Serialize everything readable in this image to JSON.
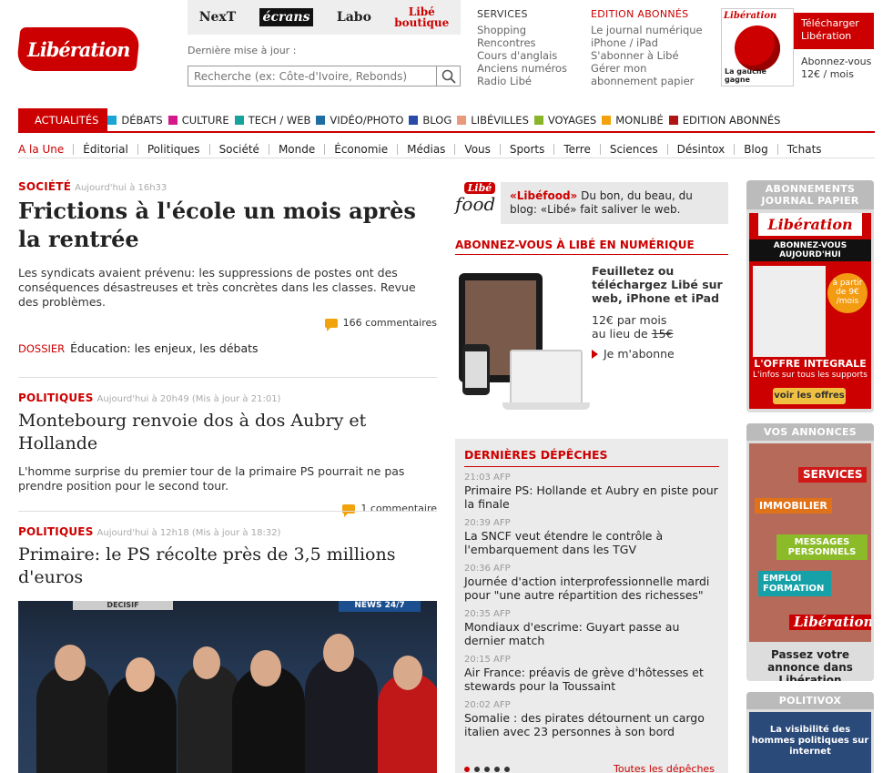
{
  "header": {
    "logo": "Libération",
    "brands": [
      "NexT",
      "écrans",
      "Labo",
      "Libé boutique"
    ],
    "last_update_label": "Dernière mise à jour :",
    "search_placeholder": "Recherche (ex: Côte-d'Ivoire, Rebonds)",
    "services": {
      "title": "SERVICES",
      "links": [
        "Shopping",
        "Rencontres",
        "Cours d'anglais",
        "Anciens numéros",
        "Radio Libé"
      ]
    },
    "abonnes": {
      "title": "EDITION ABONNÉS",
      "links": [
        "Le journal numérique",
        "iPhone / iPad",
        "S'abonner à Libé",
        "Gérer mon",
        "abonnement papier"
      ]
    },
    "cover_title": "Libération",
    "cover_caption": "La gauche gagne",
    "download": "Télécharger Libération",
    "subscribe_price": [
      "Abonnez-vous",
      "12€ / mois"
    ]
  },
  "nav": {
    "items": [
      {
        "label": "ACTUALITÉS",
        "color": "#cc0000"
      },
      {
        "label": "DÉBATS",
        "color": "#19a6d6"
      },
      {
        "label": "CULTURE",
        "color": "#d6198a"
      },
      {
        "label": "TECH / WEB",
        "color": "#17a39b"
      },
      {
        "label": "VIDÉO/PHOTO",
        "color": "#1f6ea3"
      },
      {
        "label": "BLOG",
        "color": "#2a4aa8"
      },
      {
        "label": "LIBÉVILLES",
        "color": "#e89a7a"
      },
      {
        "label": "VOYAGES",
        "color": "#8ab52a"
      },
      {
        "label": "MONLIBÉ",
        "color": "#f2a20a"
      },
      {
        "label": "EDITION ABONNÉS",
        "color": "#b01515"
      }
    ],
    "sub": [
      "A la Une",
      "Éditorial",
      "Politiques",
      "Société",
      "Monde",
      "Économie",
      "Médias",
      "Vous",
      "Sports",
      "Terre",
      "Sciences",
      "Désintox",
      "Blog",
      "Tchats"
    ]
  },
  "articles": [
    {
      "category": "SOCIÉTÉ",
      "time": "Aujourd'hui à 16h33",
      "title": "Frictions à l'école un mois après la rentrée",
      "lead": "Les syndicats avaient prévenu: les suppressions de postes ont des conséquences désastreuses et très concrètes dans les classes. Revue des problèmes.",
      "comments": "166 commentaires",
      "dossier_label": "DOSSIER",
      "dossier_text": "Éducation: les enjeux, les débats"
    },
    {
      "category": "POLITIQUES",
      "time": "Aujourd'hui à 20h49 (Mis à jour à 21:01)",
      "title": "Montebourg renvoie dos à dos Aubry et Hollande",
      "lead": "L'homme surprise du premier tour de la primaire PS pourrait ne pas prendre position pour le second tour.",
      "comments": "1 commentaire"
    },
    {
      "category": "POLITIQUES",
      "time": "Aujourd'hui à 12h18 (Mis à jour à 18:32)",
      "title": "Primaire: le PS récolte près de 3,5 millions d'euros",
      "photo_overlay_left": "DECISIF",
      "photo_overlay_right": "NEWS 24/7"
    }
  ],
  "libefood": {
    "logo_top": "Libé",
    "logo_bottom": "food",
    "name": "«Libéfood»",
    "text": " Du bon, du beau, du blog: «Libé» fait saliver le web."
  },
  "numerique": {
    "title": "ABONNEZ-VOUS À LIBÉ EN NUMÉRIQUE",
    "pitch": "Feuilletez ou téléchargez Libé sur web, iPhone et iPad",
    "price": "12€ par mois",
    "instead_of": "au lieu de ",
    "old_price": "15€",
    "cta": "Je m'abonne"
  },
  "depeches": {
    "title": "DERNIÈRES DÉPÊCHES",
    "items": [
      {
        "time": "21:03 AFP",
        "text": "Primaire PS: Hollande et Aubry en piste pour la finale"
      },
      {
        "time": "20:39 AFP",
        "text": "La SNCF veut étendre le contrôle à l'embarquement dans les TGV"
      },
      {
        "time": "20:36 AFP",
        "text": "Journée d'action interprofessionnelle mardi pour \"une autre répartition des richesses\""
      },
      {
        "time": "20:35 AFP",
        "text": "Mondiaux d'escrime: Guyart passe au dernier match"
      },
      {
        "time": "20:15 AFP",
        "text": "Air France: préavis de grève d'hôtesses et stewards pour la Toussaint"
      },
      {
        "time": "20:02 AFP",
        "text": "Somalie : des pirates détournent un cargo italien avec 23 personnes à son bord"
      }
    ],
    "all": "Toutes les dépêches"
  },
  "right": {
    "box1": {
      "title": "ABONNEMENTS JOURNAL PAPIER",
      "logo": "Libération",
      "banner": "ABONNEZ-VOUS AUJOURD'HUI",
      "circle": "à partir de 9€ /mois",
      "offre": "L'OFFRE INTEGRALE",
      "offre_sub": "L'infos sur tous les supports",
      "cta": "voir les offres"
    },
    "box2": {
      "title": "VOS ANNONCES",
      "tags": [
        "SERVICES",
        "IMMOBILIER",
        "MESSAGES PERSONNELS",
        "EMPLOI FORMATION"
      ],
      "logo": "Libération",
      "caption": "Passez votre annonce dans Libération"
    },
    "box3": {
      "title": "POLITIVOX",
      "text": "La visibilité des hommes politiques sur internet"
    }
  }
}
